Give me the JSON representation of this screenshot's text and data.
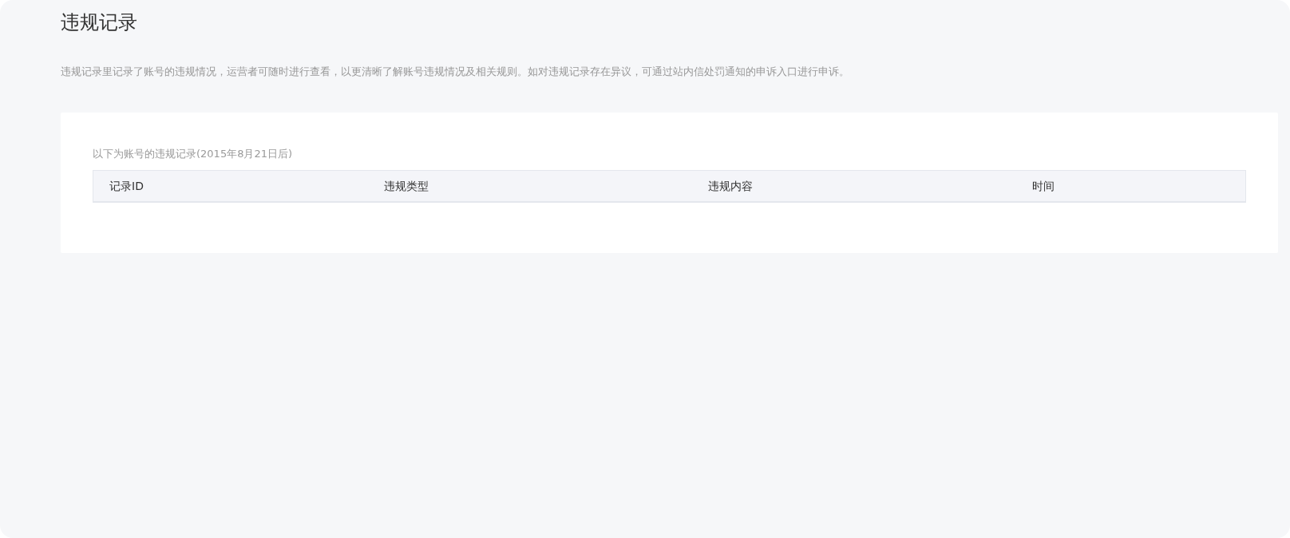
{
  "page": {
    "title": "违规记录",
    "description": "违规记录里记录了账号的违规情况，运营者可随时进行查看，以更清晰了解账号违规情况及相关规则。如对违规记录存在异议，可通过站内信处罚通知的申诉入口进行申诉。"
  },
  "records": {
    "caption": "以下为账号的违规记录(2015年8月21日后)",
    "columns": [
      "记录ID",
      "违规类型",
      "违规内容",
      "时间"
    ]
  }
}
